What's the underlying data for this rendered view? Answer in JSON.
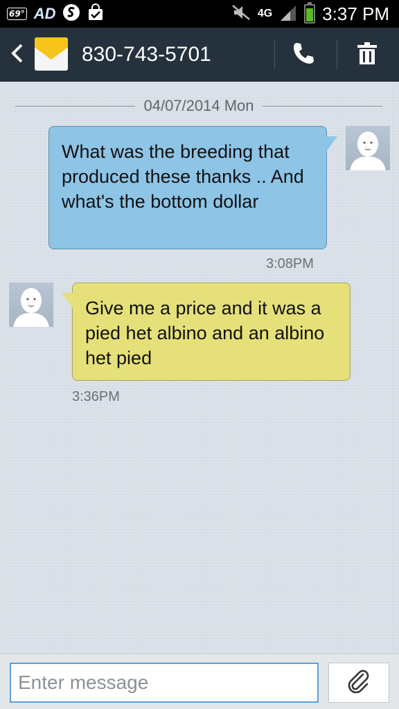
{
  "status_bar": {
    "temperature": "69°",
    "app_icon": "AD",
    "network": "4G",
    "time": "3:37 PM",
    "battery_level": 0.8,
    "icons": [
      "weather-icon",
      "ad-app-icon",
      "shazam-icon",
      "shopping-bag-check-icon",
      "mute-icon",
      "signal-icon",
      "battery-icon"
    ]
  },
  "header": {
    "contact": "830-743-5701",
    "icons": [
      "back-icon",
      "envelope-icon",
      "phone-icon",
      "trash-icon"
    ]
  },
  "conversation": {
    "date": "04/07/2014 Mon",
    "messages": [
      {
        "direction": "sent",
        "text": "What was the breeding that produced these thanks .. And what's the bottom dollar",
        "time": "3:08PM"
      },
      {
        "direction": "received",
        "text": "Give me a price and it was a pied het albino and an albino het pied",
        "time": "3:36PM"
      }
    ]
  },
  "composer": {
    "placeholder": "Enter message",
    "value": "",
    "attach_icon": "paperclip-icon"
  },
  "colors": {
    "sent_bubble": "#8ec4e6",
    "received_bubble": "#e5e07a",
    "header": "#25313c",
    "input_focus": "#5a9fd9"
  }
}
